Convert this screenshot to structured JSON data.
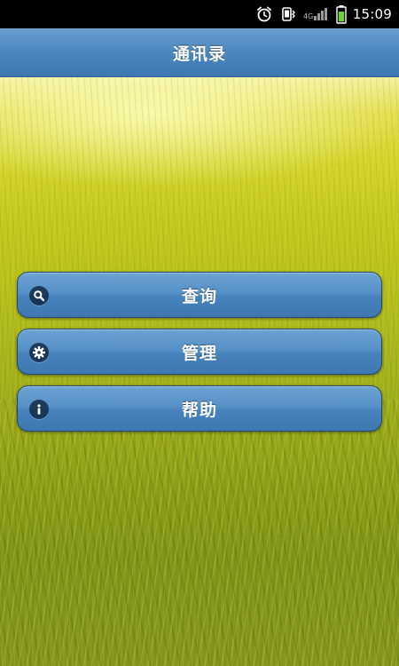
{
  "status_bar": {
    "time": "15:09",
    "network": "4G",
    "icons": [
      "alarm-icon",
      "vibrate-icon",
      "signal-icon",
      "battery-icon"
    ]
  },
  "header": {
    "title": "通讯录"
  },
  "menu": {
    "items": [
      {
        "label": "查询",
        "icon": "search-icon"
      },
      {
        "label": "管理",
        "icon": "gear-icon"
      },
      {
        "label": "帮助",
        "icon": "info-icon"
      }
    ]
  },
  "colors": {
    "header": "#4b86c0",
    "button": "#5690c7",
    "button_border": "#24496e",
    "background_field": "#b9c21a"
  }
}
